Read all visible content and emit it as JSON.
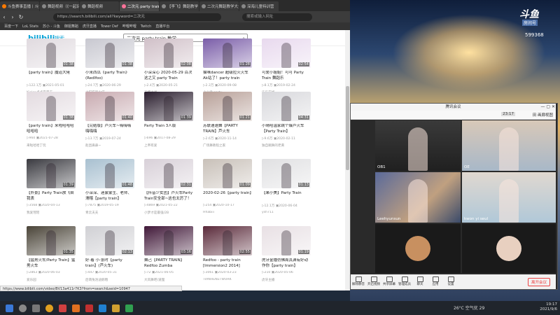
{
  "browser": {
    "tabs": [
      {
        "label": "斗鱼赛事直播丨斗鱼Ti专区",
        "color": "#ff7a00"
      },
      {
        "label": "舞蹈视频（《一起玩…",
        "color": "#888"
      },
      {
        "label": "舞蹈视频",
        "color": "#888"
      },
      {
        "label": "二次元 party train 教学",
        "color": "#fb7299",
        "active": true
      },
      {
        "label": "【李飞】舞蹈教学",
        "color": "#888"
      },
      {
        "label": "二次元舞蹈教学大全",
        "color": "#888"
      },
      {
        "label": "深海儿童特训营",
        "color": "#888"
      }
    ],
    "url": "https://search.bilibili.com/all?keyword=二次元",
    "search_placeholder": "搜索或输入网址",
    "bookmarks": [
      "百度一下",
      "LoL Stats",
      "苏小 - 斗鱼",
      "御姐舞蹈",
      "虎牙直播",
      "Tower Def",
      "哔哩哔哩",
      "Twitch",
      "直播平台"
    ],
    "status_url": "https://www.bilibili.com/video/BV13a411r7K3?from=search&seid=10947"
  },
  "bili": {
    "logo": "bilibili",
    "sub": "搜索",
    "search_value": "二次元 party train 教学"
  },
  "videos": [
    {
      "title": "【party train】魔道大佬",
      "dur": "01:38",
      "meta": "▷122.1万  ▣2021-05-01",
      "up": "Kiolop点点是最正",
      "col": "#e0dadf"
    },
    {
      "title": "小米西瓜《party Train》(Redlfoo)",
      "dur": "01:38",
      "meta": "▷24.7万  ▣2020-06-29",
      "up": "小猫猫的小仔",
      "col": "#c8c8d0"
    },
    {
      "title": "小深深心 2020-05-29 百次这之又 party Train",
      "dur": "02:08",
      "meta": "▷2.4万  ▣2020-05-21",
      "up": "天使之灵",
      "col": "#d0c0c8"
    },
    {
      "title": "猫咪dancer 超级拉火火车Ak站了！party train",
      "dur": "01:28",
      "meta": "▷2.3万  ▣2020-09-08",
      "up": "小小涂 party",
      "col": "#7a5da8"
    },
    {
      "title": "可爱小姐姐！可可 Party Train 舞蹈乐",
      "dur": "02:54",
      "meta": "▷8.1万  ▣2019-02-24",
      "up": "乐乐在线",
      "col": "#e8d9ee"
    },
    {
      "title": "【party train】来啦哈哈哈哈哈哈",
      "dur": "01:38",
      "meta": "▷960  ▣2021-07-28",
      "up": "来啦哈哈丁玩",
      "col": "#e3dbe0"
    },
    {
      "title": "【完结版】芦火车~嗨嗨嗨嗨嗨嗨",
      "dur": "01:40",
      "meta": "▷13.7万  ▣2019-07-24",
      "up": "赵团鼻鼻~",
      "col": "#c8aab0"
    },
    {
      "title": "Party Train 3人版",
      "dur": "01:39",
      "meta": "▷696  ▣2017-08-29",
      "up": "上帝有爱",
      "col": "#2a1e2e"
    },
    {
      "title": "苏联速速舞【PARTY TRAIN】芦火车",
      "dur": "01:21",
      "meta": "▷2.6万  ▣2020-11-14",
      "up": "广场舞教程之家",
      "col": "#b8a098"
    },
    {
      "title": "小晴哈温家跳个爆芦火车【Party Train】",
      "dur": "04:31",
      "meta": "▷9.6万  ▣2020-02-11",
      "up": "独自跳舞的老黄",
      "col": "#d8d8dc"
    },
    {
      "title": "【外景】Party Train放飞自我表",
      "dur": "01:39",
      "meta": "▷3568  ▣2020-04-13",
      "up": "我爱瑶瑶",
      "col": "#3a3a40"
    },
    {
      "title": "小深深、迷蒙蒙生、老师、滑稽【party train】",
      "dur": "01:48",
      "meta": "▷7875  ▣2019-05-19",
      "up": "青云夫夫",
      "col": "#a8c0d0"
    },
    {
      "title": "【抖音少女团】芦火车Party Train安全部~这也太厉了！",
      "dur": "02:31",
      "meta": "▷4869  ▣2021-05-22",
      "up": "小梦才是最强/2B",
      "col": "#d8d0d8"
    },
    {
      "title": "2020-02-26【party train】",
      "dur": "01:09",
      "meta": "▷254  ▣2020-10-17",
      "up": "Hhabiii",
      "col": "#c8c0b8"
    },
    {
      "title": "【果小美】Party Train",
      "dur": "01:13",
      "meta": "▷12.1万  ▣2020-06-04",
      "up": "ysh711",
      "col": "#e0e0e2"
    },
    {
      "title": "【猛男火车/Party Train】猛男火车",
      "dur": "01:35",
      "meta": "▷2863  ▣2020-06-03",
      "up": "爱乐园",
      "col": "#4a4438"
    },
    {
      "title": "好·着 小·张时【party train】(芦火车)",
      "dur": "02:13",
      "meta": "▷447  ▣2020-05-31",
      "up": "后萌兔洛迪鹅哦",
      "col": "#d0d0d4"
    },
    {
      "title": "舞己【PARTY TRAIN】Redfoo Zumba",
      "dur": "03:16",
      "meta": "▷72  ▣2021-06-05",
      "up": "大风舞吧(道狸",
      "col": "#401838"
    },
    {
      "title": "Redfoo - party train [Immersion2 2014]",
      "dur": "02:55",
      "meta": "▷3061  ▣2020-03-23",
      "up": "TIANHENETWORK",
      "col": "#5a2a3a"
    },
    {
      "title": "虎牙金播仿佛周其渊有好动作你【party train】",
      "dur": "01:19",
      "meta": "▷210  ▣2020-05-06",
      "up": "虎牙主播",
      "col": "#e8e0e4"
    }
  ],
  "desktop": {
    "brand": "斗鱼",
    "brand_sub": "房间号",
    "room_id": "599368"
  },
  "meeting": {
    "title": "腾讯会议",
    "timer": "23:17",
    "view": "田 画廊视图",
    "participants": [
      {
        "name": "OB1"
      },
      {
        "name": "OE"
      },
      {
        "name": "Leehyunsun"
      },
      {
        "name": "kwon yi seul"
      },
      {
        "name": ""
      },
      {
        "name": ""
      }
    ],
    "toolbar": [
      "解除静音",
      "开启视频",
      "共享屏幕",
      "管理成员",
      "聊天",
      "应用",
      "设置"
    ],
    "leave": "离开会议"
  },
  "taskbar": {
    "temp": "26°C 空气优 29",
    "time": "19:17",
    "date": "2021/9/6"
  }
}
